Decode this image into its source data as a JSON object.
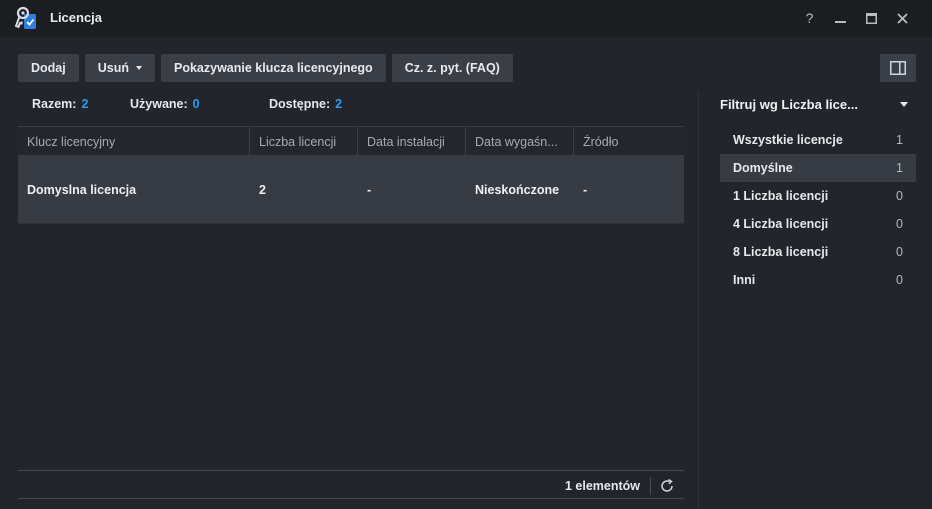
{
  "window": {
    "title": "Licencja",
    "controls": {
      "help": "?"
    }
  },
  "toolbar": {
    "add_label": "Dodaj",
    "remove_label": "Usuń",
    "show_key_label": "Pokazywanie klucza licencyjnego",
    "faq_label": "Cz. z. pyt. (FAQ)"
  },
  "stats": {
    "total_label": "Razem:",
    "total_value": "2",
    "used_label": "Używane:",
    "used_value": "0",
    "available_label": "Dostępne:",
    "available_value": "2"
  },
  "table": {
    "columns": [
      "Klucz licencyjny",
      "Liczba licencji",
      "Data instalacji",
      "Data wygaśn...",
      "Źródło"
    ],
    "rows": [
      {
        "key": "Domyslna licencja",
        "count": "2",
        "install_date": "-",
        "expiry": "Nieskończone",
        "source": "-"
      }
    ],
    "footer_count": "1 elementów"
  },
  "filter": {
    "title": "Filtruj wg Liczba lice...",
    "items": [
      {
        "label": "Wszystkie licencje",
        "count": "1",
        "selected": false
      },
      {
        "label": "Domyślne",
        "count": "1",
        "selected": true
      },
      {
        "label": "1 Liczba licencji",
        "count": "0",
        "selected": false
      },
      {
        "label": "4 Liczba licencji",
        "count": "0",
        "selected": false
      },
      {
        "label": "8 Liczba licencji",
        "count": "0",
        "selected": false
      },
      {
        "label": "Inni",
        "count": "0",
        "selected": false
      }
    ]
  },
  "colors": {
    "accent": "#2f9bf0",
    "background": "#22252b",
    "titlebar": "#1b1d21",
    "button": "#3a3f47",
    "selected_row": "#373c44"
  },
  "icons": [
    "license-key-icon",
    "help-icon",
    "minimize-icon",
    "maximize-icon",
    "close-icon",
    "dropdown-caret-icon",
    "panel-toggle-icon",
    "refresh-icon"
  ]
}
